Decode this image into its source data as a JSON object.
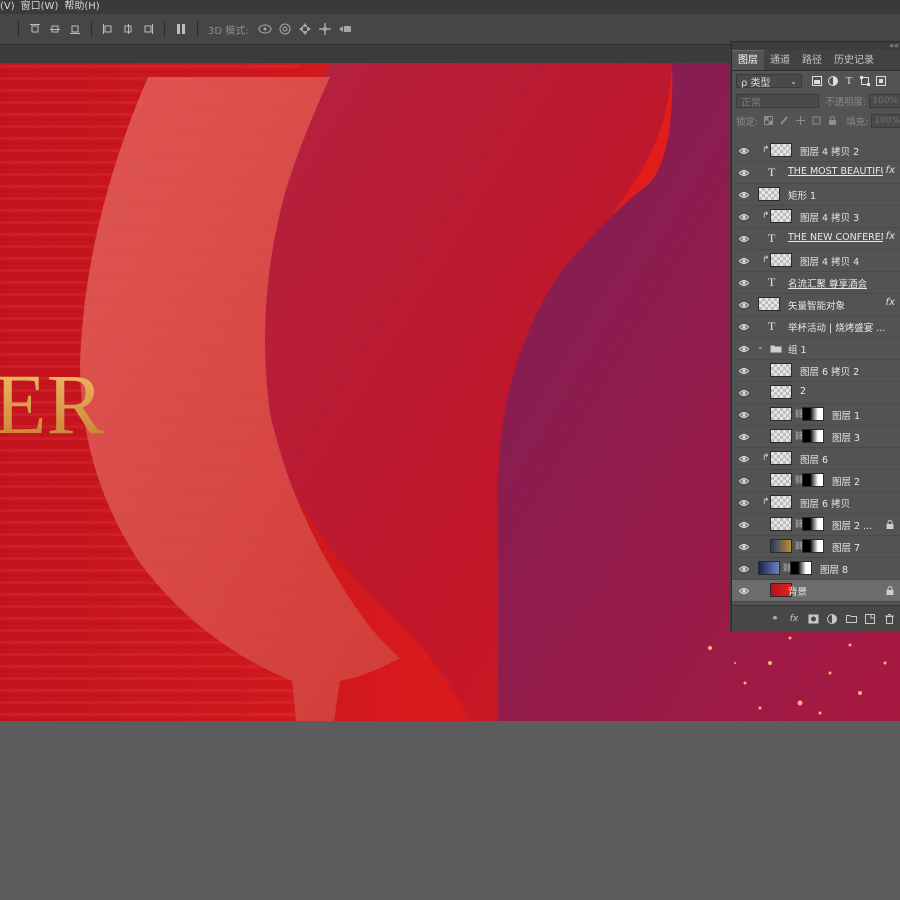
{
  "menu": {
    "items": [
      "(V)",
      "窗口(W)",
      "帮助(H)"
    ]
  },
  "options_bar": {
    "mode3d_label": "3D 模式:"
  },
  "canvas": {
    "headline_fragment": "ER"
  },
  "panel": {
    "tabs": [
      "图层",
      "通道",
      "路径",
      "历史记录"
    ],
    "filter_label": "ρ 类型",
    "blend_mode": "正常",
    "opacity_label": "不透明度:",
    "opacity_value": "100%",
    "lock_label": "锁定:",
    "fill_label": "填充:",
    "fill_value": "100%",
    "layers": [
      {
        "name": "图层 4 拷贝 2",
        "kind": "pixel",
        "clip": true
      },
      {
        "name": "THE MOST BEAUTIFUL...",
        "kind": "text",
        "fx": true
      },
      {
        "name": "矩形 1",
        "kind": "shape"
      },
      {
        "name": "图层 4 拷贝 3",
        "kind": "pixel",
        "clip": true
      },
      {
        "name": "THE NEW CONFERENCE",
        "kind": "text",
        "fx": true
      },
      {
        "name": "图层 4 拷贝 4",
        "kind": "pixel",
        "clip": true
      },
      {
        "name": "名流汇聚 尊享酒会",
        "kind": "text"
      },
      {
        "name": "矢量智能对象",
        "kind": "smart",
        "fx": true
      },
      {
        "name": "举杯活动 | 烧烤盛宴 ...",
        "kind": "text"
      },
      {
        "name": "组 1",
        "kind": "group"
      },
      {
        "name": "图层 6 拷贝 2",
        "kind": "pixel"
      },
      {
        "name": "2",
        "kind": "pixel"
      },
      {
        "name": "图层 1",
        "kind": "masked"
      },
      {
        "name": "图层 3",
        "kind": "masked"
      },
      {
        "name": "图层 6",
        "kind": "pixel",
        "clip": true
      },
      {
        "name": "图层 2",
        "kind": "masked"
      },
      {
        "name": "图层 6 拷贝",
        "kind": "pixel",
        "clip": true
      },
      {
        "name": "图层 2 ...",
        "kind": "masked",
        "locked": true
      },
      {
        "name": "图层 7",
        "kind": "masked"
      },
      {
        "name": "图层 8",
        "kind": "masked"
      },
      {
        "name": "背景",
        "kind": "background",
        "locked": true,
        "selected": true
      }
    ]
  },
  "colors": {
    "canvas_red": "#c8141c",
    "purple": "#8a1848",
    "gold": "#e0a24a",
    "panel_bg": "#535353"
  }
}
